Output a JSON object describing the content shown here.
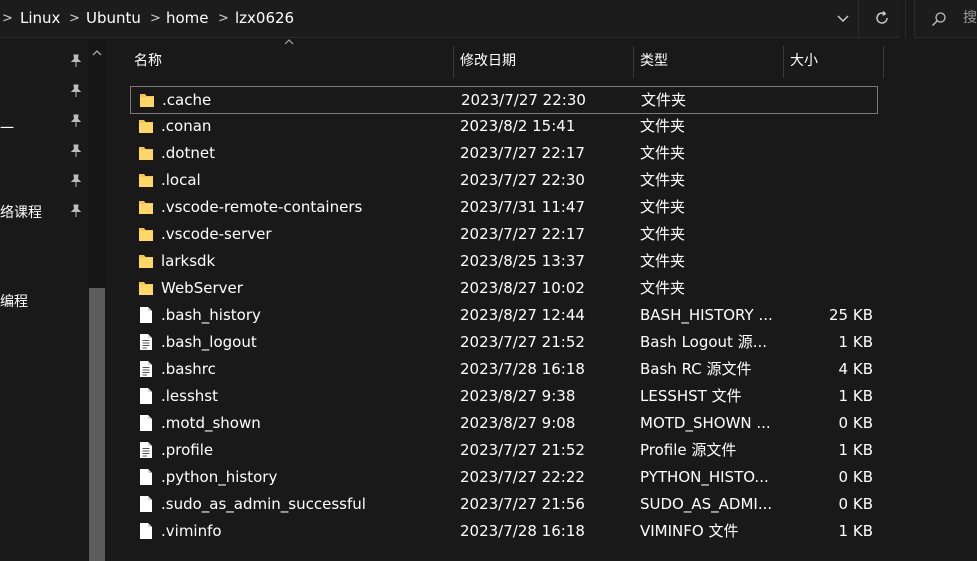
{
  "breadcrumb": {
    "items": [
      "Linux",
      "Ubuntu",
      "home",
      "lzx0626"
    ],
    "separator": ">"
  },
  "search": {
    "hint": "搜"
  },
  "navpane": {
    "fragments": [
      "一",
      "络课程",
      "编程"
    ]
  },
  "columns": {
    "name": "名称",
    "date": "修改日期",
    "type": "类型",
    "size": "大小"
  },
  "colors": {
    "background": "#191919",
    "folder": "#f5c84c",
    "selection_border": "#7a7a7a",
    "text": "#ffffff"
  },
  "files": [
    {
      "name": ".cache",
      "date": "2023/7/27 22:30",
      "type": "文件夹",
      "size": "",
      "icon": "folder-icon"
    },
    {
      "name": ".conan",
      "date": "2023/8/2 15:41",
      "type": "文件夹",
      "size": "",
      "icon": "folder-icon"
    },
    {
      "name": ".dotnet",
      "date": "2023/7/27 22:17",
      "type": "文件夹",
      "size": "",
      "icon": "folder-icon"
    },
    {
      "name": ".local",
      "date": "2023/7/27 22:30",
      "type": "文件夹",
      "size": "",
      "icon": "folder-icon"
    },
    {
      "name": ".vscode-remote-containers",
      "date": "2023/7/31 11:47",
      "type": "文件夹",
      "size": "",
      "icon": "folder-icon"
    },
    {
      "name": ".vscode-server",
      "date": "2023/7/27 22:17",
      "type": "文件夹",
      "size": "",
      "icon": "folder-icon"
    },
    {
      "name": "larksdk",
      "date": "2023/8/25 13:37",
      "type": "文件夹",
      "size": "",
      "icon": "folder-icon"
    },
    {
      "name": "WebServer",
      "date": "2023/8/27 10:02",
      "type": "文件夹",
      "size": "",
      "icon": "folder-icon"
    },
    {
      "name": ".bash_history",
      "date": "2023/8/27 12:44",
      "type": "BASH_HISTORY ...",
      "size": "25 KB",
      "icon": "file-icon"
    },
    {
      "name": ".bash_logout",
      "date": "2023/7/27 21:52",
      "type": "Bash Logout 源...",
      "size": "1 KB",
      "icon": "text-file-icon"
    },
    {
      "name": ".bashrc",
      "date": "2023/7/28 16:18",
      "type": "Bash RC 源文件",
      "size": "4 KB",
      "icon": "text-file-icon"
    },
    {
      "name": ".lesshst",
      "date": "2023/8/27 9:38",
      "type": "LESSHST 文件",
      "size": "1 KB",
      "icon": "file-icon"
    },
    {
      "name": ".motd_shown",
      "date": "2023/8/27 9:08",
      "type": "MOTD_SHOWN ...",
      "size": "0 KB",
      "icon": "file-icon"
    },
    {
      "name": ".profile",
      "date": "2023/7/27 21:52",
      "type": "Profile 源文件",
      "size": "1 KB",
      "icon": "text-file-icon"
    },
    {
      "name": ".python_history",
      "date": "2023/7/27 22:22",
      "type": "PYTHON_HISTO...",
      "size": "0 KB",
      "icon": "file-icon"
    },
    {
      "name": ".sudo_as_admin_successful",
      "date": "2023/7/27 21:56",
      "type": "SUDO_AS_ADMI...",
      "size": "0 KB",
      "icon": "file-icon"
    },
    {
      "name": ".viminfo",
      "date": "2023/7/28 16:18",
      "type": "VIMINFO 文件",
      "size": "1 KB",
      "icon": "file-icon"
    }
  ]
}
